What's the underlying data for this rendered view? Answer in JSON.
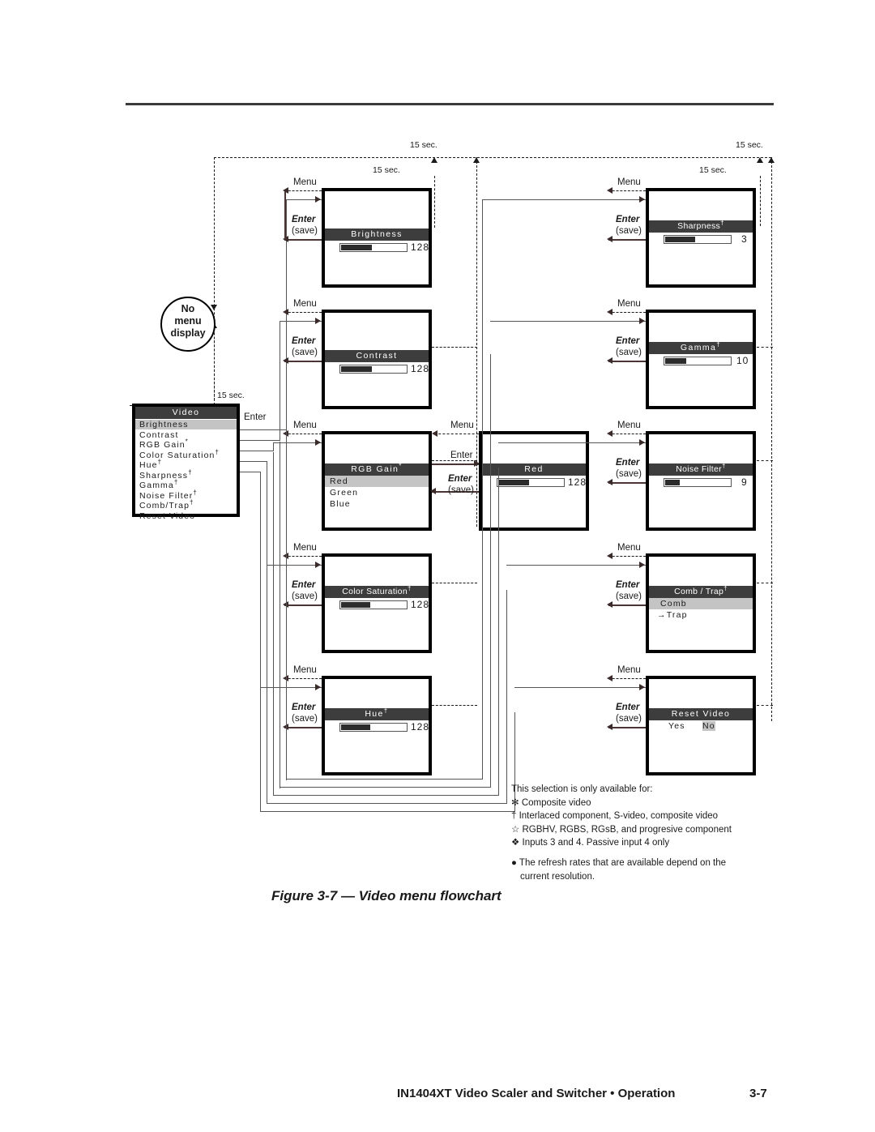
{
  "page": {
    "caption": "Figure 3-7 — Video menu flowchart",
    "footer_title": "IN1404XT Video Scaler and Switcher • Operation",
    "footer_page": "3-7"
  },
  "labels": {
    "menu": "Menu",
    "enter": "Enter",
    "enter_save_line1": "Enter",
    "enter_save_line2": "(save)",
    "timeout": "15 sec.",
    "no_menu": [
      "No",
      "menu",
      "display"
    ]
  },
  "video_menu": {
    "title": "Video",
    "items": [
      {
        "label": "Brightness",
        "selected": true
      },
      {
        "label": "Contrast",
        "selected": false
      },
      {
        "label": "RGB Gain",
        "mark": "*",
        "selected": false
      },
      {
        "label": "Color Saturation",
        "mark": "†",
        "selected": false
      },
      {
        "label": "Hue",
        "mark": "†",
        "selected": false
      },
      {
        "label": "Sharpness",
        "mark": "†",
        "selected": false
      },
      {
        "label": "Gamma",
        "mark": "†",
        "selected": false
      },
      {
        "label": "Noise Filter",
        "mark": "†",
        "selected": false
      },
      {
        "label": "Comb/Trap",
        "mark": "†",
        "selected": false
      },
      {
        "label": "Reset Video",
        "selected": false
      }
    ]
  },
  "screens": {
    "brightness": {
      "title": "Brightness",
      "value": "128",
      "fill": 47
    },
    "contrast": {
      "title": "Contrast",
      "value": "128",
      "fill": 47
    },
    "color_saturation": {
      "title": "Color Saturation",
      "mark": "†",
      "value": "128",
      "fill": 45
    },
    "hue": {
      "title": "Hue",
      "mark": "†",
      "value": "128",
      "fill": 45
    },
    "rgb_gain": {
      "title": "RGB Gain",
      "mark": "*",
      "options": [
        {
          "label": "Red",
          "selected": true
        },
        {
          "label": "Green",
          "selected": false
        },
        {
          "label": "Blue",
          "selected": false
        }
      ]
    },
    "red": {
      "title": "Red",
      "value": "128",
      "fill": 47
    },
    "sharpness": {
      "title": "Sharpness",
      "mark": "†",
      "value": "3",
      "fill": 46
    },
    "gamma": {
      "title": "Gamma",
      "mark": "†",
      "value": "10",
      "fill": 32
    },
    "noise_filter": {
      "title": "Noise Filter",
      "mark": "†",
      "value": "9",
      "fill": 22
    },
    "comb_trap": {
      "title": "Comb / Trap",
      "mark": "†",
      "options": [
        {
          "label": "Comb",
          "selected": true
        },
        {
          "label": "→Trap",
          "selected": false
        }
      ]
    },
    "reset_video": {
      "title": "Reset Video",
      "options": [
        {
          "label": "Yes",
          "selected": false
        },
        {
          "label": "No",
          "selected": true
        }
      ]
    }
  },
  "footnotes": {
    "heading": "This selection is only available for:",
    "lines": [
      "✻ Composite video",
      "† Interlaced component, S-video, composite video",
      "☆ RGBHV, RGBS, RGsB, and progresive component",
      "❖ Inputs 3 and 4.  Passive input 4 only"
    ],
    "note_line1": "● The refresh rates that are available depend on the",
    "note_line2": "current resolution."
  }
}
